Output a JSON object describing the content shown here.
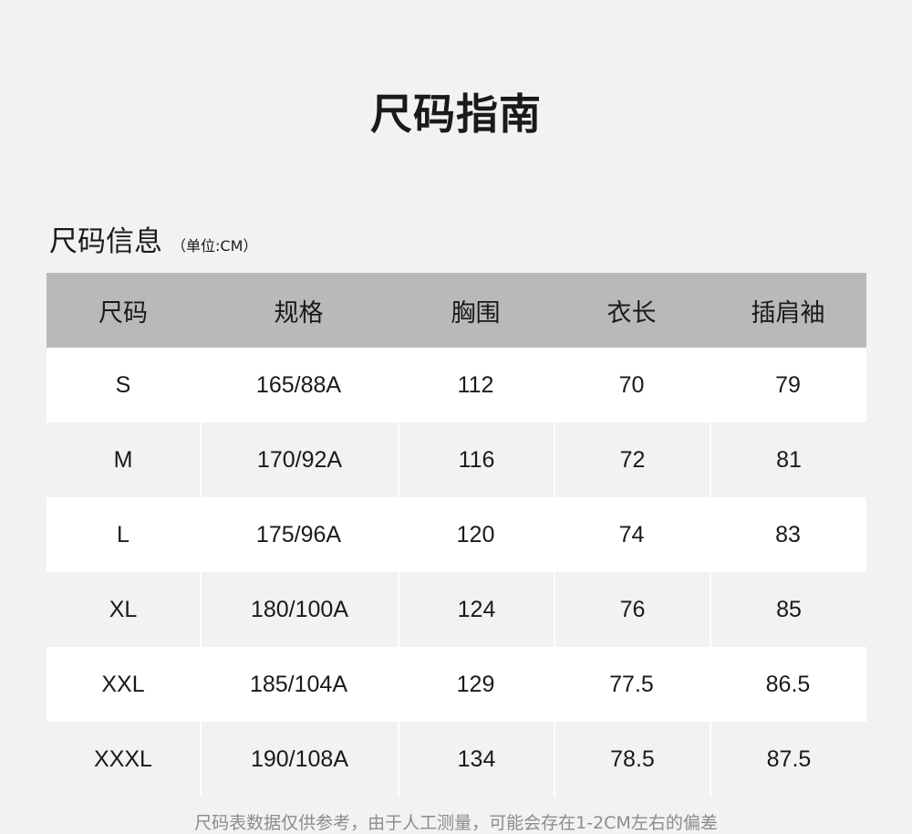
{
  "title": "尺码指南",
  "section": {
    "title": "尺码信息",
    "unit": "（单位:CM）"
  },
  "table": {
    "headers": [
      "尺码",
      "规格",
      "胸围",
      "衣长",
      "插肩袖"
    ],
    "rows": [
      [
        "S",
        "165/88A",
        "112",
        "70",
        "79"
      ],
      [
        "M",
        "170/92A",
        "116",
        "72",
        "81"
      ],
      [
        "L",
        "175/96A",
        "120",
        "74",
        "83"
      ],
      [
        "XL",
        "180/100A",
        "124",
        "76",
        "85"
      ],
      [
        "XXL",
        "185/104A",
        "129",
        "77.5",
        "86.5"
      ],
      [
        "XXXL",
        "190/108A",
        "134",
        "78.5",
        "87.5"
      ]
    ]
  },
  "footnote": "尺码表数据仅供参考，由于人工测量，可能会存在1-2CM左右的偏差"
}
